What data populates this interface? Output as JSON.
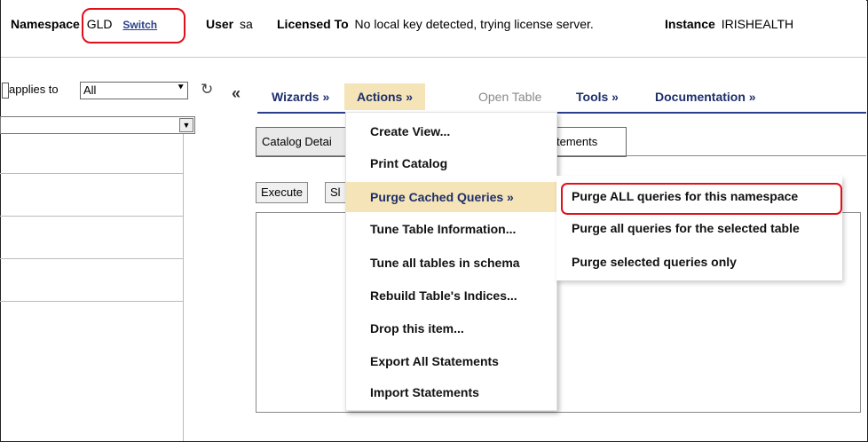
{
  "header": {
    "namespace_label": "Namespace",
    "namespace_value": "GLD",
    "switch_label": "Switch",
    "user_label": "User",
    "user_value": "sa",
    "licensed_label": "Licensed To",
    "licensed_value": "No local key detected, trying license server.",
    "instance_label": "Instance",
    "instance_value": "IRISHEALTH"
  },
  "left_panel": {
    "applies_to_label": "applies to",
    "applies_to_value": "All"
  },
  "menubar": {
    "collapse_icon": "«",
    "items": [
      {
        "label": "Wizards »"
      },
      {
        "label": "Actions »"
      },
      {
        "label": "Open Table"
      },
      {
        "label": "Tools »"
      },
      {
        "label": "Documentation »"
      }
    ]
  },
  "tabs": [
    {
      "label": "Catalog Detai"
    },
    {
      "label": "tements"
    }
  ],
  "buttons": {
    "execute": "Execute",
    "second": "Sl"
  },
  "actions_menu": [
    {
      "label": "Create View..."
    },
    {
      "label": "Print Catalog"
    },
    {
      "label": "Purge Cached Queries »"
    },
    {
      "label": "Tune Table Information..."
    },
    {
      "label": "Tune all tables in schema"
    },
    {
      "label": "Rebuild Table's Indices..."
    },
    {
      "label": "Drop this item..."
    },
    {
      "label": "Export All Statements"
    },
    {
      "label": "Import Statements"
    }
  ],
  "purge_submenu": [
    {
      "label": "Purge ALL queries for this namespace"
    },
    {
      "label": "Purge all queries for the selected table"
    },
    {
      "label": "Purge selected queries only"
    }
  ],
  "colors": {
    "accent": "#2b3f8c",
    "highlight": "#f5e4b8",
    "annotation": "#e0101a"
  },
  "icons": {
    "refresh": "refresh-icon",
    "collapse": "collapse-left-icon",
    "dropdown": "chevron-down-icon"
  }
}
